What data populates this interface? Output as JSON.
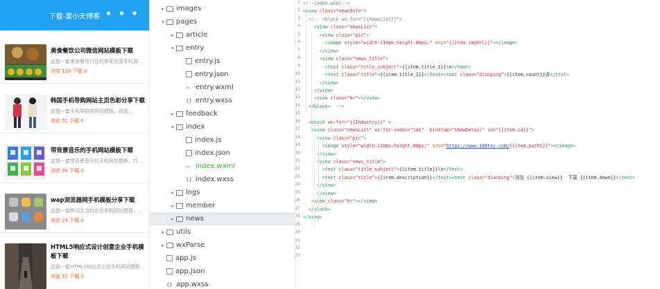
{
  "phone": {
    "title": "下载-雷小天博客",
    "menu": "• • •",
    "items": [
      {
        "title": "美食餐饮公司微信网站模板下载",
        "desc": "这是一套美食餐饮行业的商家运营手机源网...",
        "stats": "浏览 120 下载 0"
      },
      {
        "title": "韩国手机导购网站主页色彩分享下载",
        "desc": "这是一套手机导购类网站模板，页面...",
        "stats": "浏览 51 下载 6"
      },
      {
        "title": "带背景音乐的手机网站模板下载",
        "desc": "这是一套带背景音乐的手机网站模板，打开...",
        "stats": "浏览 34 下载 0"
      },
      {
        "title": "wap浏览器网手机模板分享下载",
        "desc": "这是一套移动主流的企业手机网站模板，该模...",
        "stats": "浏览 24 下载 0"
      },
      {
        "title": "HTML5响应式设计创意企业手机模板下载",
        "desc": "这是一套HTML5响应式企业手机网站模板...",
        "stats": "浏览 52 下载 0"
      }
    ]
  },
  "tree": [
    {
      "label": "images",
      "type": "folder",
      "depth": 0,
      "arrow": "▸"
    },
    {
      "label": "pages",
      "type": "folder",
      "depth": 0,
      "arrow": "▾"
    },
    {
      "label": "article",
      "type": "folder",
      "depth": 1,
      "arrow": "▸"
    },
    {
      "label": "entry",
      "type": "folder",
      "depth": 1,
      "arrow": "▾"
    },
    {
      "label": "entry.js",
      "type": "file",
      "depth": 2,
      "arrow": ""
    },
    {
      "label": "entry.json",
      "type": "file",
      "depth": 2,
      "arrow": ""
    },
    {
      "label": "entry.wxml",
      "type": "wxml",
      "depth": 2,
      "arrow": ""
    },
    {
      "label": "entry.wxss",
      "type": "wxss",
      "depth": 2,
      "arrow": ""
    },
    {
      "label": "feedback",
      "type": "folder",
      "depth": 1,
      "arrow": "▸"
    },
    {
      "label": "index",
      "type": "folder",
      "depth": 1,
      "arrow": "▾"
    },
    {
      "label": "index.js",
      "type": "file",
      "depth": 2,
      "arrow": ""
    },
    {
      "label": "index.json",
      "type": "file",
      "depth": 2,
      "arrow": ""
    },
    {
      "label": "index.wxml",
      "type": "wxml",
      "depth": 2,
      "arrow": "",
      "active": true
    },
    {
      "label": "index.wxss",
      "type": "wxss",
      "depth": 2,
      "arrow": ""
    },
    {
      "label": "logs",
      "type": "folder",
      "depth": 1,
      "arrow": "▸"
    },
    {
      "label": "member",
      "type": "folder",
      "depth": 1,
      "arrow": "▸"
    },
    {
      "label": "news",
      "type": "folder",
      "depth": 1,
      "arrow": "▸",
      "selected": true
    },
    {
      "label": "utils",
      "type": "folder",
      "depth": 0,
      "arrow": "▸"
    },
    {
      "label": "wxParse",
      "type": "folder",
      "depth": 0,
      "arrow": "▸"
    },
    {
      "label": "app.js",
      "type": "file",
      "depth": 0,
      "arrow": ""
    },
    {
      "label": "app.json",
      "type": "file",
      "depth": 0,
      "arrow": ""
    },
    {
      "label": "app.wxss",
      "type": "wxss",
      "depth": 0,
      "arrow": ""
    }
  ],
  "editor": {
    "lines": [
      "<!--index.wxml-->",
      "<view class=\"newsInfo\">",
      "  <!-- <block wx:for=\"{{newsList}}\">",
      "    <view class=\"newsList\">",
      "      <view class=\"pic\">",
      "        <image style=\"width:110px;height:80px;\" src=\"{{item.imgUrl}}\"></image>",
      "      </view>",
      "      <view class=\"news_title\">",
      "        <text class=\"title_subject\">{{item.title_1}}\\n</text>",
      "        <text class=\"title\">{{item.title_2}}</text><text class=\"dianping\">{{item.count}}评</text>",
      "      </view>",
      "    </view>",
      "    <view class=\"hr\"></view>",
      "  </block>  -->",
      "",
      "  <block wx:for=\"{{Industry}}\" >",
      "   <view class=\"newsList\" wx:for-index=\"idx\"  bindtap=\"showDetail\" id=\"{{item.id}}\">",
      "     <view class=\"pic\">",
      "       <image style=\"width:110px;height:80px;\" src=\"https://www.100txy.com/{{item.path1}}\"></image>",
      "     </view>",
      "     <view class=\"news_title\">",
      "       <text class=\"title_subject\">{{item.title}}\\n</text>",
      "       <text class=\"title\">{{item.description}}</text><text class=\"dianping\">浏览 {{item.view}}  下载 {{item.down}}</text>",
      "     </view>",
      "     </view>",
      "   <view class=\"hr\"></view>",
      "  </block>",
      "</view>",
      "",
      "",
      "",
      "",
      ""
    ]
  }
}
